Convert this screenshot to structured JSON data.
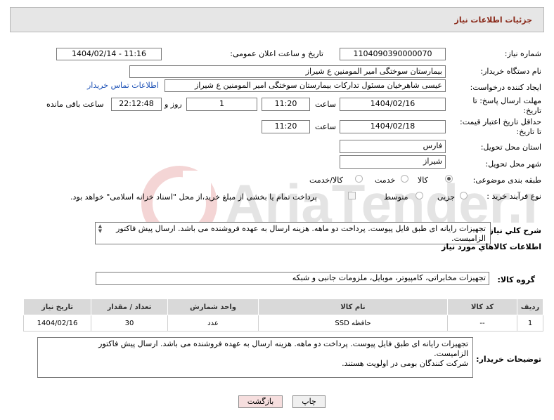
{
  "header": {
    "title": "جزئیات اطلاعات نیاز"
  },
  "form": {
    "need_number": {
      "label": "شماره نیاز:",
      "value": "1104090390000070"
    },
    "announce_datetime": {
      "label": "تاریخ و ساعت اعلان عمومی:",
      "value": "1404/02/14 - 11:16"
    },
    "buyer_org": {
      "label": "نام دستگاه خریدار:",
      "value": "بیمارستان سوختگی امیر المومنین  ع  شیراز"
    },
    "requester": {
      "label": "ایجاد کننده درخواست:",
      "value": "عیسی  شاهرخیان مسئول تدارکات بیمارستان سوختگی امیر المومنین  ع  شیراز",
      "contact_link": "اطلاعات تماس خریدار"
    },
    "reply_deadline": {
      "label_line1": "مهلت ارسال پاسخ: تا",
      "label_line2": "تاریخ:",
      "date": "1404/02/16",
      "time_label": "ساعت",
      "time": "11:20",
      "days": "1",
      "days_label": "روز و",
      "remaining": "22:12:48",
      "remaining_label": "ساعت باقی مانده"
    },
    "price_validity": {
      "label_line1": "حداقل تاریخ اعتبار قیمت:",
      "label_line2": "تا تاریخ:",
      "date": "1404/02/18",
      "time_label": "ساعت",
      "time": "11:20"
    },
    "province": {
      "label": "استان محل تحویل:",
      "value": "فارس"
    },
    "city": {
      "label": "شهر محل تحویل:",
      "value": "شیراز"
    },
    "category": {
      "label": "طبقه بندی موضوعی:",
      "options": [
        {
          "label": "کالا",
          "selected": true
        },
        {
          "label": "خدمت",
          "selected": false
        },
        {
          "label": "کالا/خدمت",
          "selected": false
        }
      ]
    },
    "process": {
      "label": "نوع فرآیند خرید :",
      "options": [
        {
          "label": "جزیی",
          "selected": false
        },
        {
          "label": "متوسط",
          "selected": false
        }
      ],
      "payment_note": "پرداخت تمام یا بخشی از مبلغ خرید،از محل \"اسناد خزانه اسلامی\" خواهد بود."
    },
    "description": {
      "label": "شرح کلي نياز:",
      "text": "تجهیزات رایانه ای طبق فایل پیوست. پرداخت دو ماهه. هزینه ارسال به عهده فروشنده می باشد. ارسال پیش فاکتور الزامیست."
    }
  },
  "goods": {
    "section_title": "اطلاعات کالاهاي مورد نياز",
    "group_label": "گروه کالا:",
    "group_value": "تجهیزات مخابراتی، کامپیوتر، موبایل، ملزومات جانبی و شبکه",
    "columns": [
      "ردیف",
      "کد کالا",
      "نام کالا",
      "واحد شمارش",
      "تعداد / مقدار",
      "تاریخ نیاز"
    ],
    "rows": [
      {
        "index": "1",
        "code": "--",
        "name": "حافظه SSD",
        "unit": "عدد",
        "qty": "30",
        "date": "1404/02/16"
      }
    ]
  },
  "buyer_notes": {
    "label": "توضیحات خریدار:",
    "lines": [
      "تجهیزات رایانه ای طبق فایل پیوست. پرداخت دو ماهه. هزینه ارسال به عهده فروشنده می باشد. ارسال پیش فاکتور",
      "الزامیست.",
      "شرکت کنندگان بومی در اولویت هستند."
    ]
  },
  "buttons": {
    "print": "چاپ",
    "back": "بازگشت"
  },
  "colors": {
    "header_title": "#8a2a1a",
    "link": "#1a4fb5",
    "back_button_bg": "#f6dede"
  }
}
